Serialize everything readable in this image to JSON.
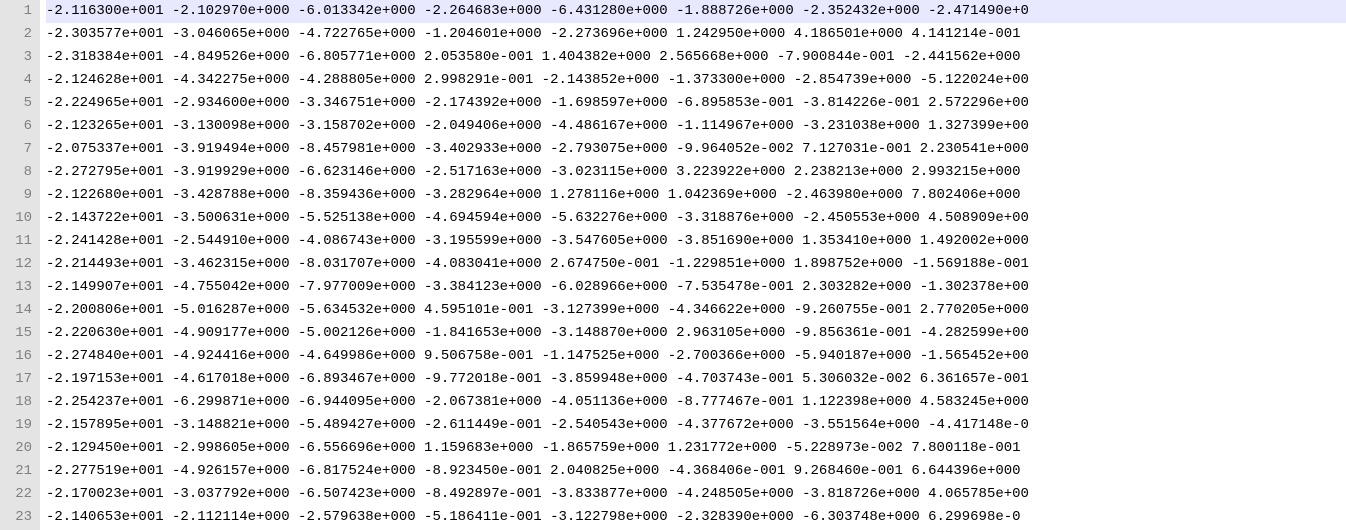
{
  "selected_line_index": 0,
  "lines": [
    "-2.116300e+001 -2.102970e+000 -6.013342e+000 -2.264683e+000 -6.431280e+000 -1.888726e+000 -2.352432e+000 -2.471490e+0",
    "-2.303577e+001 -3.046065e+000 -4.722765e+000 -1.204601e+000 -2.273696e+000 1.242950e+000 4.186501e+000 4.141214e-001",
    "-2.318384e+001 -4.849526e+000 -6.805771e+000 2.053580e-001 1.404382e+000 2.565668e+000 -7.900844e-001 -2.441562e+000",
    "-2.124628e+001 -4.342275e+000 -4.288805e+000 2.998291e-001 -2.143852e+000 -1.373300e+000 -2.854739e+000 -5.122024e+00",
    "-2.224965e+001 -2.934600e+000 -3.346751e+000 -2.174392e+000 -1.698597e+000 -6.895853e-001 -3.814226e-001 2.572296e+00",
    "-2.123265e+001 -3.130098e+000 -3.158702e+000 -2.049406e+000 -4.486167e+000 -1.114967e+000 -3.231038e+000 1.327399e+00",
    "-2.075337e+001 -3.919494e+000 -8.457981e+000 -3.402933e+000 -2.793075e+000 -9.964052e-002 7.127031e-001 2.230541e+000",
    "-2.272795e+001 -3.919929e+000 -6.623146e+000 -2.517163e+000 -3.023115e+000 3.223922e+000 2.238213e+000 2.993215e+000",
    "-2.122680e+001 -3.428788e+000 -8.359436e+000 -3.282964e+000 1.278116e+000 1.042369e+000 -2.463980e+000 7.802406e+000",
    "-2.143722e+001 -3.500631e+000 -5.525138e+000 -4.694594e+000 -5.632276e+000 -3.318876e+000 -2.450553e+000 4.508909e+00",
    "-2.241428e+001 -2.544910e+000 -4.086743e+000 -3.195599e+000 -3.547605e+000 -3.851690e+000 1.353410e+000 1.492002e+000",
    "-2.214493e+001 -3.462315e+000 -8.031707e+000 -4.083041e+000 2.674750e-001 -1.229851e+000 1.898752e+000 -1.569188e-001",
    "-2.149907e+001 -4.755042e+000 -7.977009e+000 -3.384123e+000 -6.028966e+000 -7.535478e-001 2.303282e+000 -1.302378e+00",
    "-2.200806e+001 -5.016287e+000 -5.634532e+000 4.595101e-001 -3.127399e+000 -4.346622e+000 -9.260755e-001 2.770205e+000",
    "-2.220630e+001 -4.909177e+000 -5.002126e+000 -1.841653e+000 -3.148870e+000 2.963105e+000 -9.856361e-001 -4.282599e+00",
    "-2.274840e+001 -4.924416e+000 -4.649986e+000 9.506758e-001 -1.147525e+000 -2.700366e+000 -5.940187e+000 -1.565452e+00",
    "-2.197153e+001 -4.617018e+000 -6.893467e+000 -9.772018e-001 -3.859948e+000 -4.703743e-001 5.306032e-002 6.361657e-001",
    "-2.254237e+001 -6.299871e+000 -6.944095e+000 -2.067381e+000 -4.051136e+000 -8.777467e-001 1.122398e+000 4.583245e+000",
    "-2.157895e+001 -3.148821e+000 -5.489427e+000 -2.611449e-001 -2.540543e+000 -4.377672e+000 -3.551564e+000 -4.417148e-0",
    "-2.129450e+001 -2.998605e+000 -6.556696e+000 1.159683e+000 -1.865759e+000 1.231772e+000 -5.228973e-002 7.800118e-001",
    "-2.277519e+001 -4.926157e+000 -6.817524e+000 -8.923450e-001 2.040825e+000 -4.368406e-001 9.268460e-001 6.644396e+000",
    "-2.170023e+001 -3.037792e+000 -6.507423e+000 -8.492897e-001 -3.833877e+000 -4.248505e+000 -3.818726e+000 4.065785e+00",
    "-2.140653e+001 -2.112114e+000 -2.579638e+000 -5.186411e-001 -3.122798e+000 -2.328390e+000 -6.303748e+000 6.299698e-0"
  ],
  "watermark": ""
}
